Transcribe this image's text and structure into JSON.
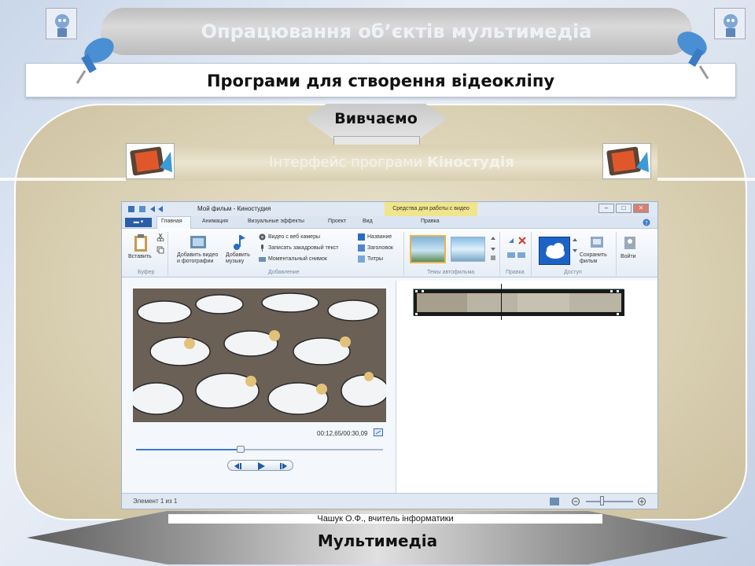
{
  "header": {
    "title": "Опрацювання об’єктів мультимедіа",
    "subtitle": "Програми для створення відеокліпу"
  },
  "study_tab": {
    "label": "Вивчаємо"
  },
  "section": {
    "title_regular": "Інтерфейс програми ",
    "title_bold": "Кіностудія"
  },
  "app": {
    "window_title": "Мой фильм - Киностудия",
    "context_tab": "Средства для работы с видео",
    "file_menu": "▬ ▾",
    "tabs": [
      "Главная",
      "Анимация",
      "Визуальные эффекты",
      "Проект",
      "Вид",
      "Правка"
    ],
    "ribbon": {
      "paste": "Вставить",
      "add_video": "Добавить видео\nи фотографии",
      "add_music": "Добавить\nмузыку",
      "webcam": "Видео с веб камеры",
      "narration": "Записать закадровый текст",
      "snapshot": "Моментальный снимок",
      "title": "Название",
      "caption": "Заголовок",
      "credits": "Титры",
      "save_movie": "Сохранить\nфильм",
      "signin": "Войти"
    },
    "groups": [
      "Буфер",
      "Добавление",
      "Темы автофильма",
      "Правка",
      "Доступ"
    ],
    "time": "00:12,65/00:30,09",
    "status": "Элемент 1 из 1",
    "colors": {
      "accent": "#2a5da8",
      "context": "#f0e58c"
    }
  },
  "footer": {
    "author": "Чашук О.Ф., вчитель інформатики",
    "bottom_label": "Мультимедіа"
  }
}
